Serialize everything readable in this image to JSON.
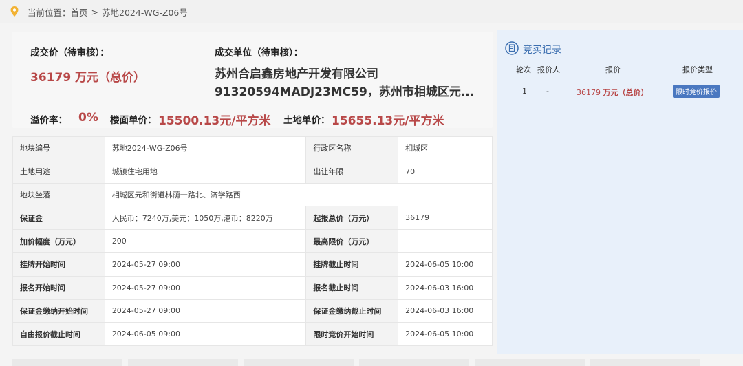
{
  "breadcrumb": {
    "prefix": "当前位置：",
    "home": "首页",
    "separator": ">",
    "current": "苏地2024-WG-Z06号"
  },
  "summary": {
    "price_label": "成交价（待审核）：",
    "price_value": "36179 万元（总价）",
    "buyer_label": "成交单位（待审核）：",
    "buyer_line1": "苏州合启鑫房地产开发有限公司",
    "buyer_line2": "91320594MADJ23MC59，苏州市相城区元...",
    "premium_label": "溢价率：",
    "premium_value": "0%",
    "floor_label": "楼面单价：",
    "floor_value": "15500.13元/平方米",
    "land_label": "土地单价：",
    "land_value": "15655.13元/平方米"
  },
  "info_table": {
    "r1": {
      "k1": "地块编号",
      "v1": "苏地2024-WG-Z06号",
      "k2": "行政区名称",
      "v2": "相城区"
    },
    "r2": {
      "k1": "土地用途",
      "v1": "城镇住宅用地",
      "k2": "出让年限",
      "v2": "70"
    },
    "r3": {
      "k1": "地块坐落",
      "v1": "相城区元和街道林荫一路北、济学路西"
    },
    "r4": {
      "k1": "保证金",
      "v1": "人民币：7240万,美元：1050万,港币：8220万",
      "k2": "起报总价（万元）",
      "v2": "36179"
    },
    "r5": {
      "k1": "加价幅度（万元）",
      "v1": "200",
      "k2": "最高限价（万元）",
      "v2": ""
    },
    "r6": {
      "k1": "挂牌开始时间",
      "v1": "2024-05-27 09:00",
      "k2": "挂牌截止时间",
      "v2": "2024-06-05 10:00"
    },
    "r7": {
      "k1": "报名开始时间",
      "v1": "2024-05-27 09:00",
      "k2": "报名截止时间",
      "v2": "2024-06-03 16:00"
    },
    "r8": {
      "k1": "保证金缴纳开始时间",
      "v1": "2024-05-27 09:00",
      "k2": "保证金缴纳截止时间",
      "v2": "2024-06-03 16:00"
    },
    "r9": {
      "k1": "自由报价截止时间",
      "v1": "2024-06-05 09:00",
      "k2": "限时竞价开始时间",
      "v2": "2024-06-05 10:00"
    }
  },
  "bid_record": {
    "title": "竞买记录",
    "headers": {
      "round": "轮次",
      "bidder": "报价人",
      "price": "报价",
      "type": "报价类型"
    },
    "row": {
      "round": "1",
      "bidder": "-",
      "price_num": "36179",
      "price_unit": "万元（总价）",
      "type": "限时竞价报价"
    }
  },
  "colors": {
    "accent_red": "#b84848",
    "accent_blue": "#3c6fb0",
    "pin_yellow": "#f2b233"
  }
}
